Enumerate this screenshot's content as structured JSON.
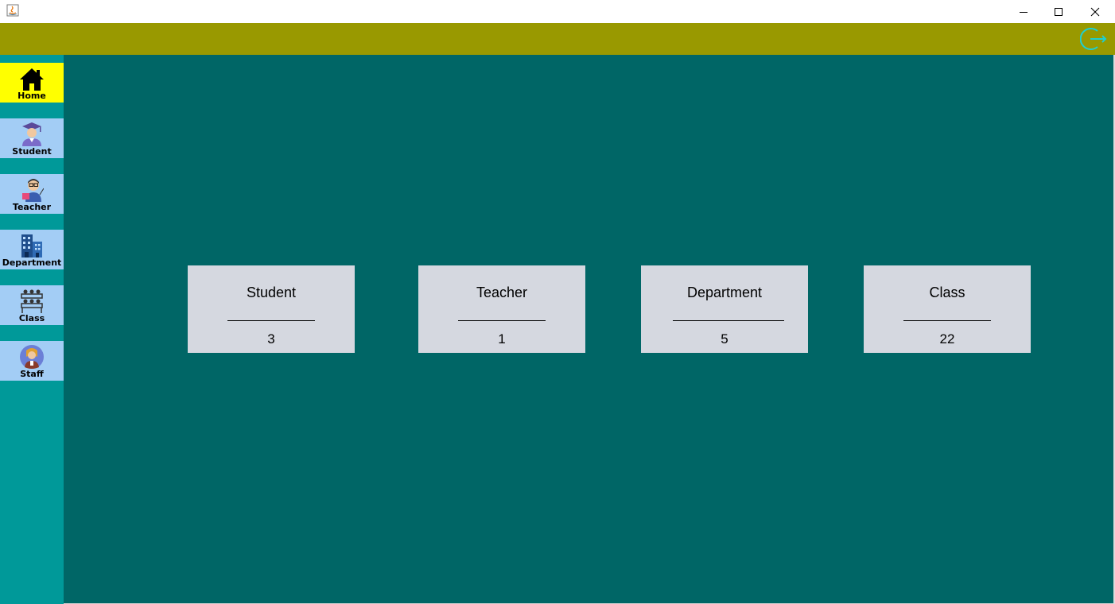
{
  "window": {
    "controls": [
      "minimize-icon",
      "maximize-icon",
      "close-icon"
    ]
  },
  "header": {
    "bg_color": "#999900",
    "logout_icon": "logout-icon",
    "logout_color": "#1ecfd0"
  },
  "sidebar": {
    "bg_color": "#009999",
    "items": [
      {
        "label": "Home",
        "icon": "home-icon",
        "active": true
      },
      {
        "label": "Student",
        "icon": "student-icon",
        "active": false
      },
      {
        "label": "Teacher",
        "icon": "teacher-icon",
        "active": false
      },
      {
        "label": "Department",
        "icon": "department-icon",
        "active": false
      },
      {
        "label": "Class",
        "icon": "class-icon",
        "active": false
      },
      {
        "label": "Staff",
        "icon": "staff-icon",
        "active": false
      }
    ],
    "active_color": "#ffff00",
    "item_color": "#a3cdf5"
  },
  "main": {
    "bg_color": "#006666",
    "cards": [
      {
        "title": "Student",
        "value": "3"
      },
      {
        "title": "Teacher",
        "value": "1"
      },
      {
        "title": "Department",
        "value": "5"
      },
      {
        "title": "Class",
        "value": "22"
      }
    ]
  }
}
